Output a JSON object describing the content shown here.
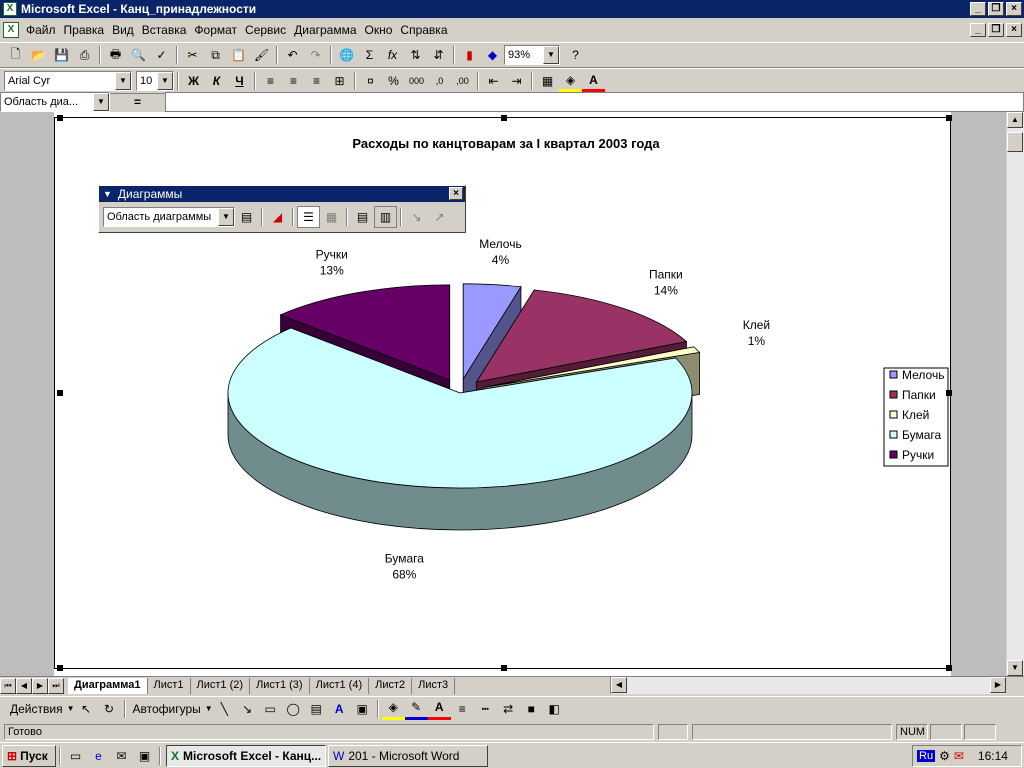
{
  "window": {
    "title": "Microsoft Excel - Канц_принадлежности"
  },
  "menu": [
    "Файл",
    "Правка",
    "Вид",
    "Вставка",
    "Формат",
    "Сервис",
    "Диаграмма",
    "Окно",
    "Справка"
  ],
  "toolbar": {
    "zoom": "93%",
    "font": "Arial Cyr",
    "font_size": "10",
    "bold": "Ж",
    "italic": "К",
    "underline": "Ч"
  },
  "formula": {
    "name_box": "Область диа...",
    "equals": "="
  },
  "float_toolbar": {
    "title": "Диаграммы",
    "object_select": "Область диаграммы"
  },
  "chart_data": {
    "type": "pie",
    "title": "Расходы по канцтоварам за I квартал 2003 года",
    "categories": [
      "Мелочь",
      "Папки",
      "Клей",
      "Бумага",
      "Ручки"
    ],
    "values": [
      4,
      14,
      1,
      68,
      13
    ],
    "labels": [
      "4%",
      "14%",
      "1%",
      "68%",
      "13%"
    ],
    "colors": [
      "#9999ff",
      "#993366",
      "#ffffcc",
      "#ccffff",
      "#660066"
    ],
    "legend": "right",
    "three_d": true
  },
  "tabs": [
    "Диаграмма1",
    "Лист1",
    "Лист1 (2)",
    "Лист1 (3)",
    "Лист1 (4)",
    "Лист2",
    "Лист3"
  ],
  "drawing": {
    "actions": "Действия",
    "autoshapes": "Автофигуры"
  },
  "status": {
    "ready": "Готово",
    "num": "NUM"
  },
  "taskbar": {
    "start": "Пуск",
    "task1": "Microsoft Excel - Канц...",
    "task2": "201 - Microsoft Word",
    "lang": "Ru",
    "time": "16:14"
  }
}
